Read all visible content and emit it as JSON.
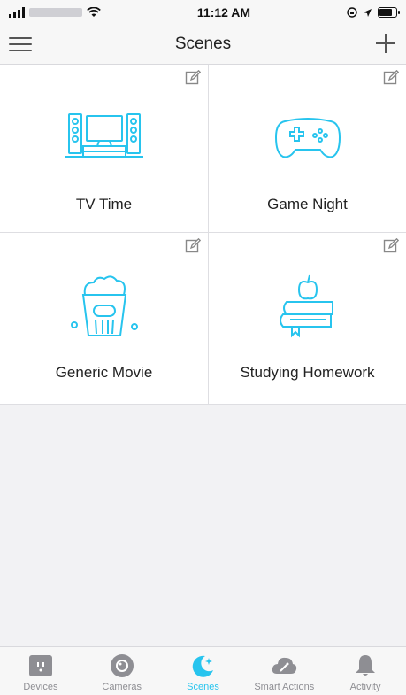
{
  "status_bar": {
    "time": "11:12 AM"
  },
  "nav": {
    "title": "Scenes"
  },
  "scenes": [
    {
      "label": "TV Time",
      "icon": "tv-icon"
    },
    {
      "label": "Game Night",
      "icon": "gamepad-icon"
    },
    {
      "label": "Generic Movie",
      "icon": "popcorn-icon"
    },
    {
      "label": "Studying Homework",
      "icon": "books-apple-icon"
    }
  ],
  "tabs": [
    {
      "label": "Devices",
      "icon": "plug-icon",
      "active": false
    },
    {
      "label": "Cameras",
      "icon": "camera-icon",
      "active": false
    },
    {
      "label": "Scenes",
      "icon": "moon-sparkle-icon",
      "active": true
    },
    {
      "label": "Smart Actions",
      "icon": "cloud-wand-icon",
      "active": false
    },
    {
      "label": "Activity",
      "icon": "bell-icon",
      "active": false
    }
  ],
  "colors": {
    "accent": "#27c4ee",
    "icon_gray": "#8e8e93"
  }
}
